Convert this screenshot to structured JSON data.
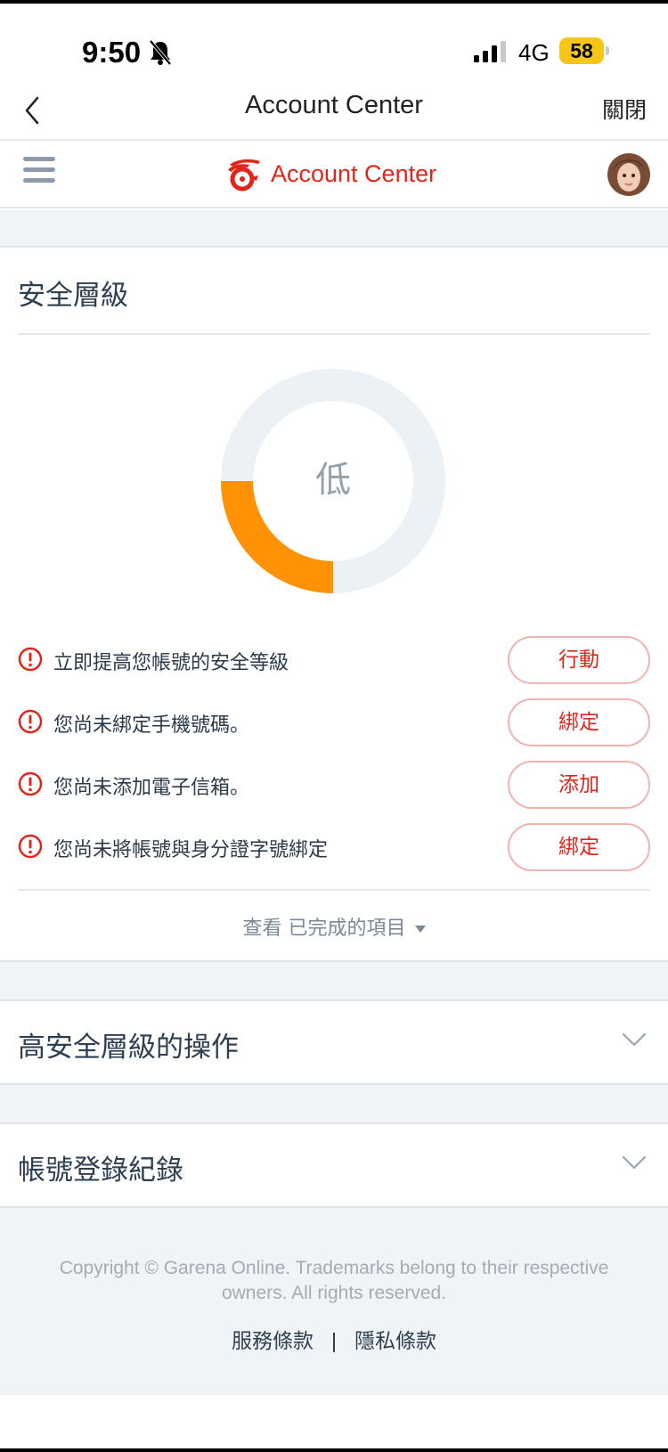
{
  "status_bar": {
    "time": "9:50",
    "network": "4G",
    "battery": "58"
  },
  "nav": {
    "title": "Account Center",
    "close_label": "關閉"
  },
  "header": {
    "brand_text": "Account Center",
    "brand_color": "#e1251b"
  },
  "security": {
    "title": "安全層級",
    "level_label": "低",
    "level_fraction": 0.25,
    "gauge_colors": {
      "track": "#ecf1f5",
      "fill": "#ff9305"
    },
    "tasks": [
      {
        "text": "立即提高您帳號的安全等級",
        "button": "行動"
      },
      {
        "text": "您尚未綁定手機號碼。",
        "button": "綁定"
      },
      {
        "text": "您尚未添加電子信箱。",
        "button": "添加"
      },
      {
        "text": "您尚未將帳號與身分證字號綁定",
        "button": "綁定"
      }
    ],
    "completed_label": "查看 已完成的項目"
  },
  "sections": {
    "high_security_title": "高安全層級的操作",
    "login_history_title": "帳號登錄紀錄"
  },
  "footer": {
    "copyright": "Copyright © Garena Online. Trademarks belong to their respective owners. All rights reserved.",
    "terms_label": "服務條款",
    "privacy_label": "隱私條款"
  }
}
